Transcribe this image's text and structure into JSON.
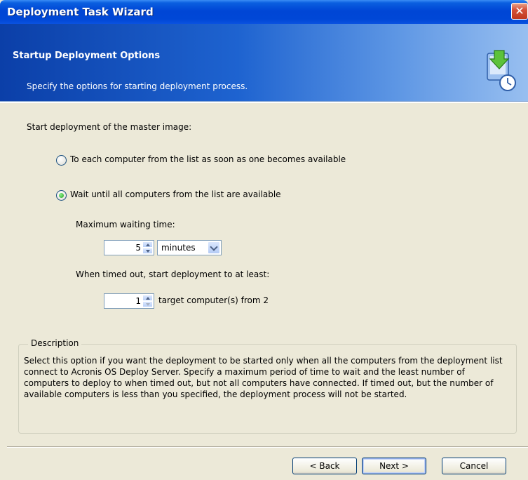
{
  "window": {
    "title": "Deployment Task Wizard",
    "close_symbol": "✕"
  },
  "header": {
    "title": "Startup Deployment Options",
    "subtitle": "Specify the options for starting deployment process."
  },
  "main": {
    "prompt": "Start deployment of the master image:",
    "options": [
      {
        "label": "To each computer from the list as soon as one becomes available",
        "checked": false
      },
      {
        "label": "Wait until all computers from the list are available",
        "checked": true
      }
    ],
    "max_wait_label": "Maximum waiting time:",
    "max_wait_value": "5",
    "max_wait_unit": "minutes",
    "timeout_label": "When timed out, start deployment to at least:",
    "min_computers_value": "1",
    "min_computers_suffix": "target computer(s) from 2"
  },
  "description": {
    "legend": "Description",
    "text": "Select this option if you want the deployment to be started only when all the computers from the deployment list connect to Acronis OS Deploy Server. Specify a maximum period of time to wait and the least number of computers to deploy to when timed out, but not all computers have connected. If timed out, but the number of available computers is less than you specified, the deployment process will not be started."
  },
  "footer": {
    "back_label": "< Back",
    "next_label": "Next >",
    "cancel_label": "Cancel"
  },
  "colors": {
    "title_blue": "#0046d5",
    "radio_green": "#21a121",
    "close_red": "#d4513a"
  }
}
